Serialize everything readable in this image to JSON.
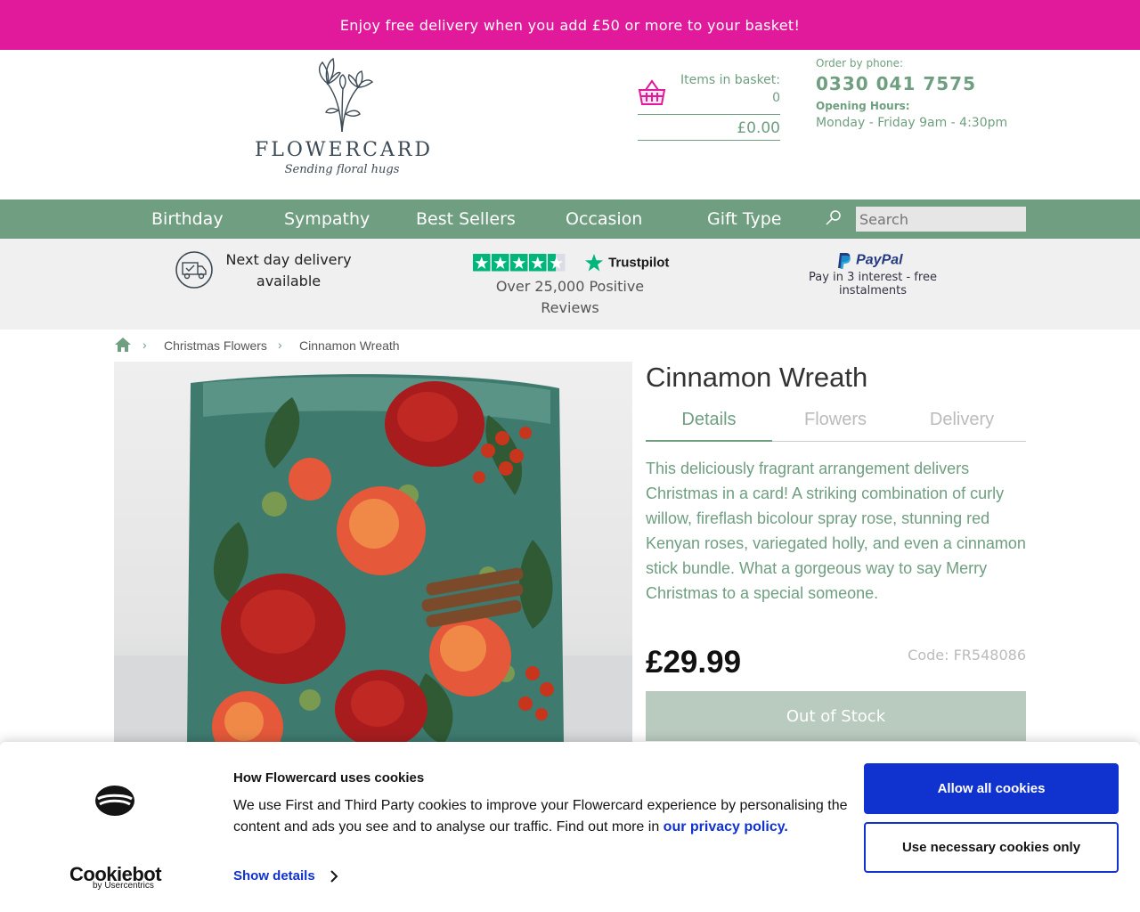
{
  "promo": {
    "text": "Enjoy free delivery when you add £50 or more to your basket!"
  },
  "header": {
    "brand": "FLOWERCARD",
    "tagline": "Sending floral hugs",
    "basket": {
      "items_label": "Items in basket:",
      "items_count": "0",
      "total": "£0.00"
    },
    "phone": {
      "label": "Order by phone:",
      "number": "0330 041 7575",
      "hours_label": "Opening Hours:",
      "hours": "Monday - Friday 9am - 4:30pm"
    }
  },
  "nav": {
    "items": [
      {
        "label": "Birthday"
      },
      {
        "label": "Sympathy"
      },
      {
        "label": "Best Sellers"
      },
      {
        "label": "Occasion"
      },
      {
        "label": "Gift Type"
      }
    ],
    "search_placeholder": "Search"
  },
  "usp": {
    "delivery": "Next day delivery available",
    "trustpilot_brand": "Trustpilot",
    "reviews": "Over 25,000 Positive Reviews",
    "paypal_brand": "PayPal",
    "paypal_text": "Pay in 3 interest - free instalments"
  },
  "breadcrumb": {
    "items": [
      "Christmas Flowers",
      "Cinnamon Wreath"
    ]
  },
  "product": {
    "title": "Cinnamon Wreath",
    "tabs": [
      "Details",
      "Flowers",
      "Delivery"
    ],
    "active_tab": "Details",
    "description": "This deliciously fragrant arrangement delivers Christmas in a card! A striking combination of curly willow, fireflash bicolour spray rose, stunning red Kenyan roses, variegated holly, and even a cinnamon stick bundle. What a gorgeous way to say Merry Christmas to a special someone.",
    "price": "£29.99",
    "code": "Code: FR548086",
    "stock_button": "Out of Stock"
  },
  "cookie": {
    "brand": "Cookiebot",
    "brand_sub": "by Usercentrics",
    "title": "How Flowercard uses cookies",
    "text": "We use First and Third Party cookies to improve your Flowercard experience by personalising the content and ads you see and to analyse our traffic. Find out more in",
    "link": "our privacy policy.",
    "details": "Show details",
    "allow_all": "Allow all cookies",
    "necessary_only": "Use necessary cookies only"
  },
  "colors": {
    "promo": "#e1199b",
    "brand_green": "#6f9e80",
    "cookie_blue": "#1032cf"
  }
}
